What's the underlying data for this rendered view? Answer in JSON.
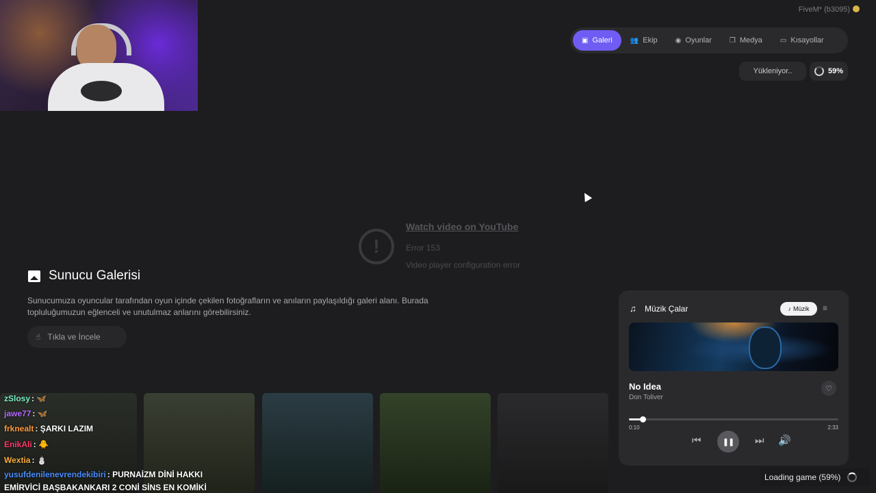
{
  "header": {
    "fivem_label": "FiveM* (b3095)",
    "nav": [
      {
        "label": "Galeri",
        "icon": "image-icon",
        "active": true
      },
      {
        "label": "Ekip",
        "icon": "team-icon",
        "active": false
      },
      {
        "label": "Oyunlar",
        "icon": "gamepad-icon",
        "active": false
      },
      {
        "label": "Medya",
        "icon": "media-icon",
        "active": false
      },
      {
        "label": "Kısayollar",
        "icon": "keyboard-icon",
        "active": false
      }
    ],
    "loading_label": "Yükleniyor..",
    "loading_percent": "59%"
  },
  "video_error": {
    "link": "Watch video on YouTube",
    "code": "Error 153",
    "message": "Video player configuration error"
  },
  "gallery": {
    "title": "Sunucu Galerisi",
    "description": "Sunucumuza oyuncular tarafından oyun içinde çekilen fotoğrafların ve anıların paylaşıldığı galeri alanı. Burada topluluğumuzun eğlenceli ve unutulmaz anlarını görebilirsiniz.",
    "button": "Tıkla ve İncele"
  },
  "chat": [
    {
      "user": "zSlosy",
      "msg": "🦋",
      "color": "#7cf0c8"
    },
    {
      "user": "jawe77",
      "msg": "🦋",
      "color": "#b46cff"
    },
    {
      "user": "frkneal‍t",
      "msg": "ŞARKI LAZIM",
      "color": "#ff9a3c"
    },
    {
      "user": "EnikAli",
      "msg": "🐥",
      "color": "#ff3a6a"
    },
    {
      "user": "Wextia",
      "msg": "⛄",
      "color": "#ffae3c"
    },
    {
      "user": "yusufdenilenevrendekibiri",
      "msg": "PURNAİZM DİNİ HAKKI",
      "color": "#4a8cff"
    },
    {
      "user": "",
      "msg": "EMİRVİCİ BAŞBAKANKARI 2 CONİ SİNS EN KOMİKİ",
      "color": "#ffffff"
    }
  ],
  "player": {
    "title": "Müzik Çalar",
    "tab": "Müzik",
    "song": "No Idea",
    "artist": "Don Toliver",
    "time_current": "0:10",
    "time_total": "2:33",
    "progress": 0.065
  },
  "status": {
    "loading_game": "Loading game (59%)"
  }
}
